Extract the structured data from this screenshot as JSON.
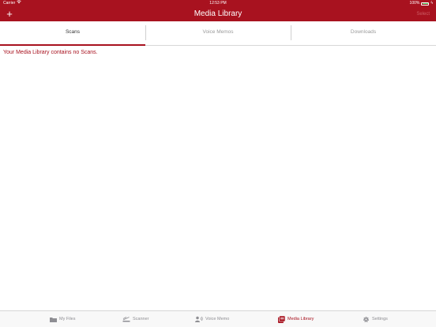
{
  "status_bar": {
    "carrier": "Carrier",
    "time": "12:53 PM",
    "battery": "100%"
  },
  "nav": {
    "title": "Media Library",
    "select_label": "Select",
    "add_symbol": "+"
  },
  "segments": [
    {
      "label": "Scans",
      "active": true
    },
    {
      "label": "Voice Memos",
      "active": false
    },
    {
      "label": "Downloads",
      "active": false
    }
  ],
  "content": {
    "empty_message": "Your Media Library contains no Scans."
  },
  "tab_bar": {
    "items": [
      {
        "label": "My Files",
        "icon": "folder-icon"
      },
      {
        "label": "Scanner",
        "icon": "scanner-icon"
      },
      {
        "label": "Voice Memo",
        "icon": "voice-memo-icon"
      },
      {
        "label": "Media Library",
        "icon": "media-library-icon",
        "active": true
      },
      {
        "label": "Settings",
        "icon": "gear-icon"
      }
    ]
  },
  "colors": {
    "accent": "#a8121f",
    "inactive": "#8e8e93",
    "battery": "#4cd964"
  }
}
